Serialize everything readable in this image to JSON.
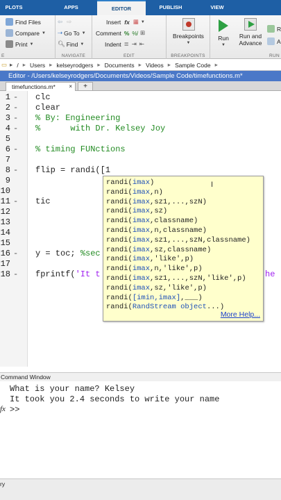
{
  "tabs": [
    {
      "label": "PLOTS"
    },
    {
      "label": "APPS"
    },
    {
      "label": "EDITOR"
    },
    {
      "label": "PUBLISH"
    },
    {
      "label": "VIEW"
    }
  ],
  "ribbon": {
    "file": {
      "find_files": "Find Files",
      "compare": "Compare",
      "print": "Print"
    },
    "navigate": {
      "go_to": "Go To",
      "find": "Find",
      "label": "NAVIGATE"
    },
    "edit": {
      "insert": "Insert",
      "comment": "Comment",
      "indent": "Indent",
      "label": "EDIT",
      "fx": "fx"
    },
    "breakpoints": {
      "button": "Breakpoints",
      "label": "BREAKPOINTS"
    },
    "run": {
      "run": "Run",
      "run_advance_1": "Run and",
      "run_advance_2": "Advance",
      "label": "RUN"
    }
  },
  "address": {
    "segments": [
      "/",
      "Users",
      "kelseyrodgers",
      "Documents",
      "Videos",
      "Sample Code"
    ]
  },
  "editor": {
    "title": "Editor - /Users/kelseyrodgers/Documents/Videos/Sample Code/timefunctions.m*",
    "file_tab": "timefunctions.m*",
    "add_tab": "+",
    "lines": [
      {
        "num": "1",
        "code": "clc"
      },
      {
        "num": "2",
        "code": "clear"
      },
      {
        "num": "3",
        "code": "% By: Engineering"
      },
      {
        "num": "4",
        "code": "%      with Dr. Kelsey Joy"
      },
      {
        "num": "5",
        "code": ""
      },
      {
        "num": "6",
        "code": "% timing FUNctions"
      },
      {
        "num": "7",
        "code": ""
      },
      {
        "num": "8",
        "code": "flip = randi([1"
      },
      {
        "num": "9",
        "code": ""
      },
      {
        "num": "10",
        "code": ""
      },
      {
        "num": "11",
        "code": "tic"
      },
      {
        "num": "12",
        "code": ""
      },
      {
        "num": "13",
        "code": ""
      },
      {
        "num": "14",
        "code": ""
      },
      {
        "num": "15",
        "code": ""
      },
      {
        "num": "16",
        "code": "y = toc; %sec"
      },
      {
        "num": "17",
        "code": ""
      },
      {
        "num": "18",
        "code": "fprintf('It t",
        "tail": "he"
      }
    ]
  },
  "autocomplete": {
    "items": [
      {
        "fn": "randi(",
        "args": "imax",
        "rest": ")"
      },
      {
        "fn": "randi(",
        "args": "imax",
        "rest": ",n)"
      },
      {
        "fn": "randi(",
        "args": "imax",
        "rest": ",sz1,...,szN)"
      },
      {
        "fn": "randi(",
        "args": "imax",
        "rest": ",sz)"
      },
      {
        "fn": "randi(",
        "args": "imax",
        "rest": ",classname)"
      },
      {
        "fn": "randi(",
        "args": "imax",
        "rest": ",n,classname)"
      },
      {
        "fn": "randi(",
        "args": "imax",
        "rest": ",sz1,...,szN,classname)"
      },
      {
        "fn": "randi(",
        "args": "imax",
        "rest": ",sz,classname)"
      },
      {
        "fn": "randi(",
        "args": "imax",
        "rest": ",'like',p)"
      },
      {
        "fn": "randi(",
        "args": "imax",
        "rest": ",n,'like',p)"
      },
      {
        "fn": "randi(",
        "args": "imax",
        "rest": ",sz1,...,szN,'like',p)"
      },
      {
        "fn": "randi(",
        "args": "imax",
        "rest": ",sz,'like',p)"
      },
      {
        "fn": "randi(",
        "args": "[imin,imax]",
        "rest": ",___)"
      },
      {
        "fn": "randi(",
        "args": "RandStream object",
        "rest": "...)"
      }
    ],
    "more_help": "More Help..."
  },
  "command_window": {
    "title": "Command Window",
    "lines": [
      "What is your name? Kelsey",
      "It took you 2.4 seconds to write your name",
      ">>"
    ],
    "fx": "fx"
  },
  "status": {
    "text": "ry"
  },
  "colors": {
    "tab_bar": "#1e5fa5",
    "title_bar": "#4a78c8",
    "popup_bg": "#ffffcc",
    "comment": "#228b22",
    "string": "#a020f0"
  }
}
